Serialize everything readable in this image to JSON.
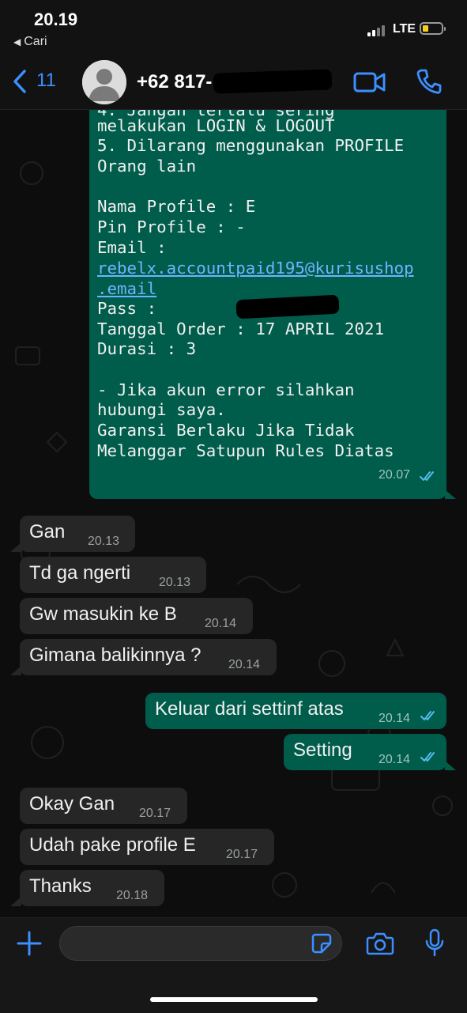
{
  "status_bar": {
    "time": "20.19",
    "back_app": "Cari",
    "network": "LTE"
  },
  "header": {
    "back_count": "11",
    "contact": "+62 817-"
  },
  "long_message": {
    "lines": [
      "4. Jangan terlalu sering",
      "melakukan LOGIN & LOGOUT",
      "5. Dilarang menggunakan PROFILE",
      "Orang lain",
      "",
      "Nama Profile : E",
      "Pin Profile : -",
      "Email :",
      "rebelx.accountpaid195@kurisushop",
      ".email",
      "Pass :",
      "Tanggal Order : 17 APRIL 2021",
      "Durasi : 3",
      "",
      "- Jika akun error silahkan",
      "hubungi saya.",
      "Garansi Berlaku Jika Tidak",
      "Melanggar Satupun Rules Diatas"
    ],
    "time": "20.07"
  },
  "messages": [
    {
      "text": "Gan",
      "time": "20.13",
      "dir": "in"
    },
    {
      "text": "Td ga ngerti",
      "time": "20.13",
      "dir": "in"
    },
    {
      "text": "Gw masukin ke B",
      "time": "20.14",
      "dir": "in"
    },
    {
      "text": "Gimana balikinnya ?",
      "time": "20.14",
      "dir": "in"
    },
    {
      "text": "Keluar dari settinf atas",
      "time": "20.14",
      "dir": "out"
    },
    {
      "text": "Setting",
      "time": "20.14",
      "dir": "out"
    },
    {
      "text": "Okay Gan",
      "time": "20.17",
      "dir": "in"
    },
    {
      "text": "Udah pake profile E",
      "time": "20.17",
      "dir": "in"
    },
    {
      "text": "Thanks",
      "time": "20.18",
      "dir": "in"
    }
  ],
  "colors": {
    "accent": "#3d8fff",
    "outgoing": "#005c4b",
    "incoming": "#262626",
    "read_ticks": "#53bdeb"
  },
  "icons": [
    "chevron-left-icon",
    "video-icon",
    "phone-icon",
    "plus-icon",
    "sticker-icon",
    "camera-icon",
    "mic-icon"
  ]
}
